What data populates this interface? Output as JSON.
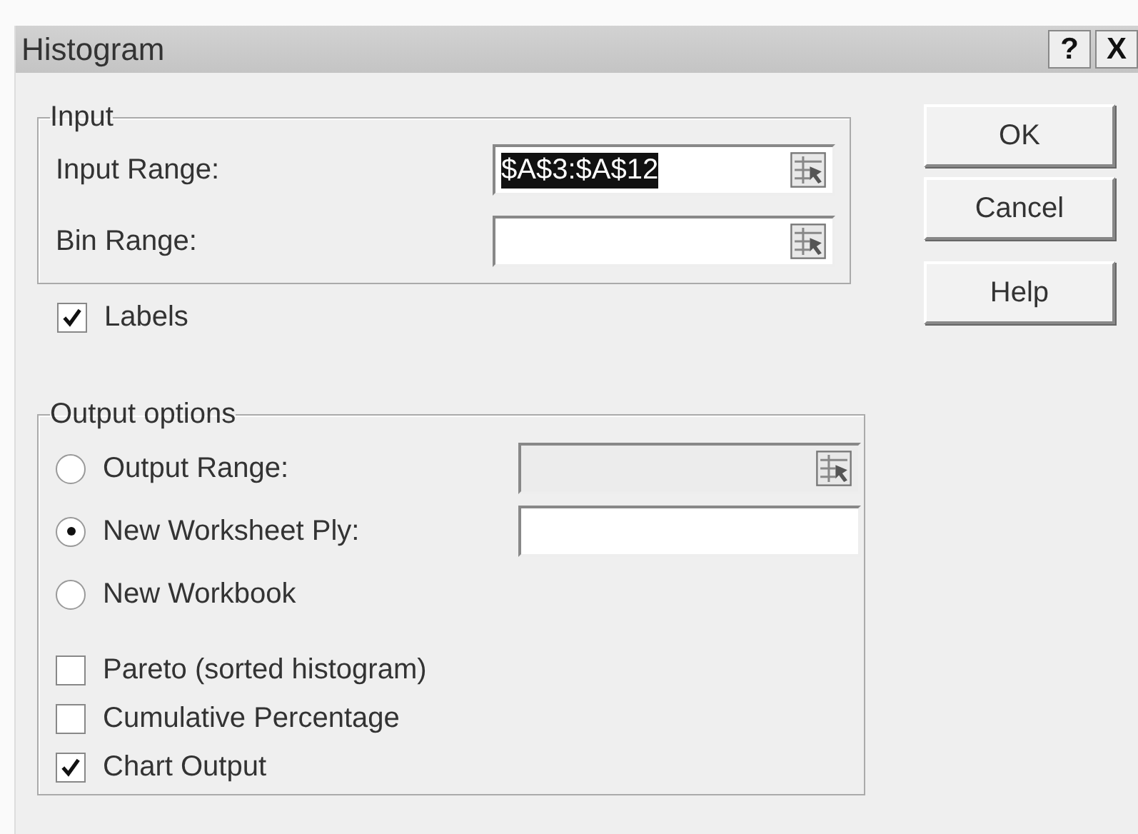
{
  "window": {
    "title": "Histogram",
    "controls": [
      "?",
      "X"
    ]
  },
  "input_group": {
    "legend": "Input",
    "fields": [
      {
        "label": "Input Range:",
        "value": "$A$3:$A$12",
        "value_selected": true,
        "kind": "range"
      },
      {
        "label": "Bin Range:",
        "kind": "range"
      }
    ]
  },
  "labels_checkbox": {
    "label": "Labels",
    "checked": true
  },
  "output_group": {
    "legend": "Output options",
    "options": [
      {
        "kind": "radio",
        "label": "Output Range:",
        "selected": false,
        "field": {
          "kind": "range",
          "disabled": true
        }
      },
      {
        "kind": "radio",
        "label": "New Worksheet Ply:",
        "selected": true,
        "field": {
          "kind": "text",
          "disabled": false
        }
      },
      {
        "kind": "radio",
        "label": "New Workbook",
        "selected": false
      },
      {
        "kind": "checkbox",
        "label": "Pareto (sorted histogram)",
        "checked": false
      },
      {
        "kind": "checkbox",
        "label": "Cumulative Percentage",
        "checked": false
      },
      {
        "kind": "checkbox",
        "label": "Chart Output",
        "checked": true
      }
    ]
  },
  "buttons": [
    {
      "label": "OK"
    },
    {
      "label": "Cancel"
    },
    {
      "label": "Help"
    }
  ]
}
